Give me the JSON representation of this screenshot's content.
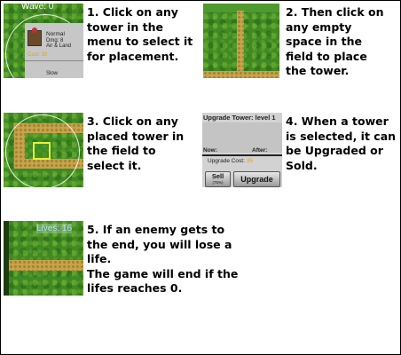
{
  "steps": [
    {
      "lines": [
        "1. Click on any",
        "tower in the",
        "menu to select it",
        "for placement."
      ]
    },
    {
      "lines": [
        "2. Then click on",
        "any empty",
        "space in the",
        "field to place",
        "the tower."
      ]
    },
    {
      "lines": [
        "3. Click on any",
        "placed tower in",
        "the field to",
        "select it."
      ]
    },
    {
      "lines": [
        "4. When a tower",
        "is selected, it can",
        "be Upgraded or",
        "Sold."
      ]
    },
    {
      "lines": [
        "5. If an enemy gets to",
        "the end, you will lose a",
        "life.",
        "The game will end if the",
        "lifes reaches 0."
      ]
    }
  ],
  "shot1": {
    "wave_label": "Wave: 0",
    "tower_type": "Normal",
    "tower_dmg": "Dmg: 8",
    "tower_target": "Air & Land",
    "tower_cost": "Cost: 30",
    "next_label": "Slow"
  },
  "shot4": {
    "header": "Upgrade Tower: level 1",
    "now_label": "Now:",
    "after_label": "After:",
    "upgrade_cost_label": "Upgrade Cost:",
    "upgrade_cost_value": "35",
    "sell_label": "Sell",
    "sell_pct": "(75%)",
    "upgrade_label": "Upgrade"
  },
  "shot5": {
    "lives_label": "Lives: 16"
  },
  "colors": {
    "grass": "#3f8a24",
    "path": "#c9a44a",
    "highlight": "#e6f03a",
    "cost_text": "#e0a020",
    "lives_text": "#a9e6ff"
  }
}
